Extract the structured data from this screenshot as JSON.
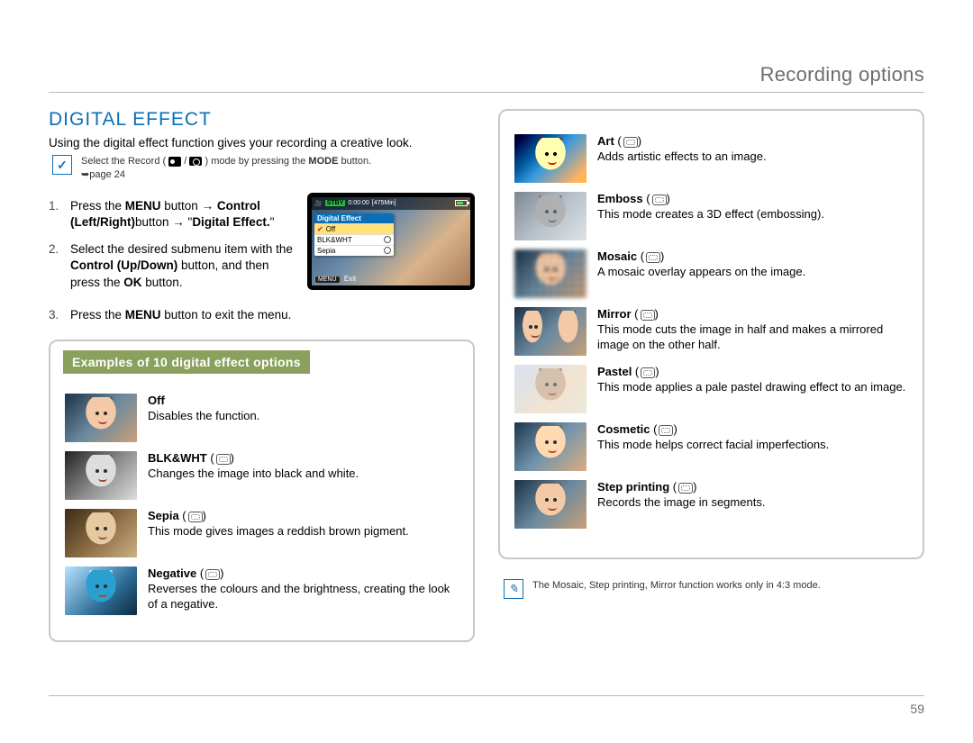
{
  "header": {
    "title": "Recording options"
  },
  "page_number": "59",
  "section": {
    "heading": "DIGITAL EFFECT",
    "intro": "Using the digital effect function gives your recording a creative look."
  },
  "tip": {
    "prefix": "Select the Record (",
    "mid": " / ",
    "suffix": ") mode by pressing the ",
    "mode_bold": "MODE",
    "suffix2": " button.",
    "pageref": "page 24"
  },
  "steps": [
    {
      "num": "1.",
      "t1": "Press the ",
      "b1": "MENU",
      "t2": " button → ",
      "b2": "Control (Left/Right)",
      "t3": "button → \"",
      "b3": "Digital Effect.",
      "t4": "\""
    },
    {
      "num": "2.",
      "t1": "Select the desired submenu item with the ",
      "b1": "Control (Up/Down)",
      "t2": " button, and then press the ",
      "b2": "OK",
      "t3": " button."
    },
    {
      "num": "3.",
      "t1": "Press the ",
      "b1": "MENU",
      "t2": " button to exit the menu."
    }
  ],
  "lcd": {
    "stby": "STBY",
    "time": "0:00:00",
    "remain": "[475Min]",
    "menu_title": "Digital Effect",
    "rows": [
      {
        "label": "Off",
        "selected": true,
        "check": true
      },
      {
        "label": "BLK&WHT",
        "selected": false
      },
      {
        "label": "Sepia",
        "selected": false
      }
    ],
    "exit": "Exit",
    "menu_btn": "MENU"
  },
  "panel_heading": "Examples of 10 digital effect options",
  "effects_left": [
    {
      "name": "Off",
      "desc": "Disables the function.",
      "noicon": true,
      "cls": "t-normal"
    },
    {
      "name": "BLK&WHT",
      "desc": "Changes the image into black and white.",
      "cls": "t-bw"
    },
    {
      "name": "Sepia",
      "desc": "This mode gives images a reddish brown pigment.",
      "cls": "t-sepia"
    },
    {
      "name": "Negative",
      "desc": "Reverses the colours and the brightness, creating the look of a negative.",
      "cls": "t-neg"
    }
  ],
  "effects_right": [
    {
      "name": "Art",
      "desc": "Adds artistic effects to an image.",
      "cls": "t-normal t-art"
    },
    {
      "name": "Emboss",
      "desc": "This mode creates a 3D effect (embossing).",
      "cls": "t-emboss"
    },
    {
      "name": "Mosaic",
      "desc": "A mosaic overlay appears on the image.",
      "cls": "t-normal t-mosaic"
    },
    {
      "name": "Mirror",
      "desc": "This mode cuts the image in half and makes a mirrored image on the other half.",
      "cls": "t-normal t-mirror"
    },
    {
      "name": "Pastel",
      "desc": "This mode applies a pale pastel drawing effect to an image.",
      "cls": "t-pastel"
    },
    {
      "name": "Cosmetic",
      "desc": "This mode helps correct facial imperfections.",
      "cls": "t-normal t-cosmetic"
    },
    {
      "name": "Step printing",
      "desc": "Records the image in segments.",
      "cls": "t-normal t-step"
    }
  ],
  "note": "The Mosaic, Step printing, Mirror function works only in 4:3 mode."
}
